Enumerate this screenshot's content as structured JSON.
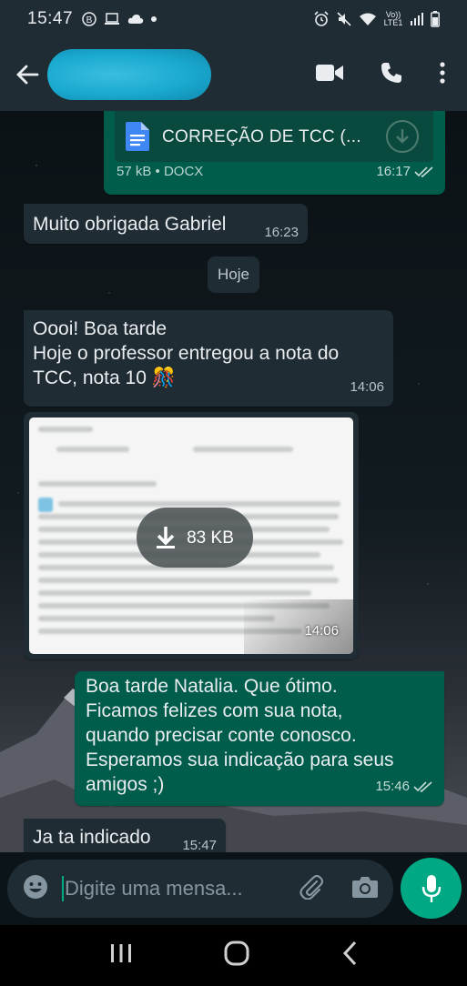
{
  "status_bar": {
    "time": "15:47",
    "network_label": "Vo)) LTE1"
  },
  "header": {},
  "chat": {
    "doc_message": {
      "file_name": "CORREÇÃO DE TCC (...",
      "file_info": "57 kB • DOCX",
      "time": "16:17"
    },
    "msg1": {
      "text": "Muito obrigada Gabriel",
      "time": "16:23"
    },
    "date_chip": "Hoje",
    "msg2": {
      "lines": [
        "Oooi! Boa tarde",
        "Hoje o professor entregou a nota do",
        "TCC, nota 10"
      ],
      "emoji": "🎊",
      "time": "14:06"
    },
    "image_msg": {
      "download_size": "83 KB",
      "time": "14:06"
    },
    "msg3": {
      "lines": [
        "Boa tarde Natalia. Que ótimo.",
        "Ficamos felizes com sua nota,",
        "quando precisar conte conosco.",
        "Esperamos sua indicação para seus",
        "amigos ;)"
      ],
      "time": "15:46"
    },
    "msg4": {
      "text": "Ja ta indicado",
      "time": "15:47"
    }
  },
  "composer": {
    "placeholder": "Digite uma mensa..."
  },
  "colors": {
    "accent": "#00a884",
    "outgoing": "#005c4b",
    "incoming": "#1f2c34"
  }
}
